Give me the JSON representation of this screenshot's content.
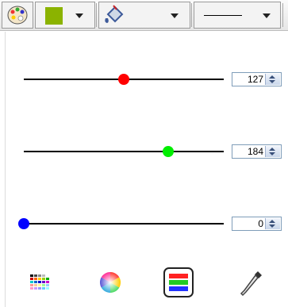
{
  "toolbar": {
    "palette_icon": "palette-icon",
    "fill_color": "#8bb300",
    "paint_bucket_icon": "paint-bucket-icon",
    "line_style_icon": "line-style-icon"
  },
  "sliders": [
    {
      "name": "red",
      "value": "127",
      "color": "#ff0000",
      "max": 255
    },
    {
      "name": "green",
      "value": "184",
      "color": "#00ee00",
      "max": 255
    },
    {
      "name": "blue",
      "value": "0",
      "color": "#0000ff",
      "max": 255
    }
  ],
  "bottom_icons": [
    "swatch-grid-icon",
    "color-wheel-icon",
    "rgb-sliders-icon",
    "eyedropper-icon"
  ]
}
